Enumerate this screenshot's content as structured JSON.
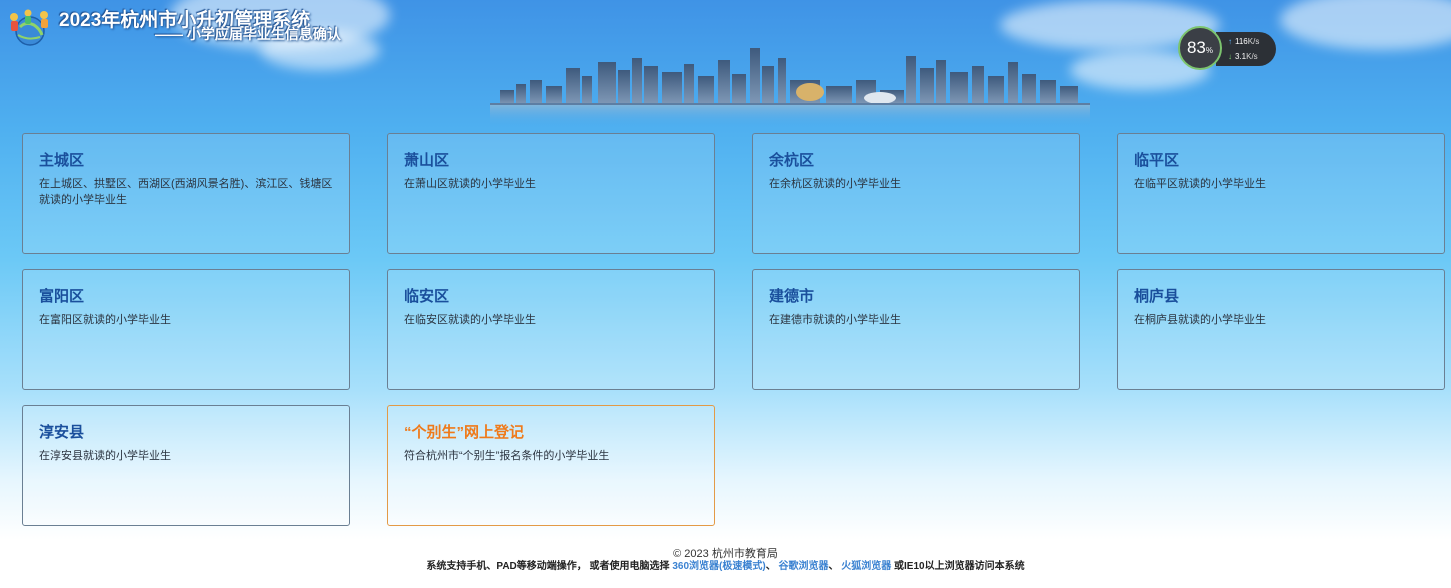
{
  "header": {
    "title": "2023年杭州市小升初管理系统",
    "subtitle": "—— 小学应届毕业生信息确认"
  },
  "net_widget": {
    "percent": "83",
    "percent_unit": "%",
    "upload": "116",
    "upload_unit": "K/s",
    "download": "3.1",
    "download_unit": "K/s"
  },
  "districts": [
    {
      "title": "主城区",
      "desc": "在上城区、拱墅区、西湖区(西湖风景名胜)、滨江区、钱塘区就读的小学毕业生"
    },
    {
      "title": "萧山区",
      "desc": "在萧山区就读的小学毕业生"
    },
    {
      "title": "余杭区",
      "desc": "在余杭区就读的小学毕业生"
    },
    {
      "title": "临平区",
      "desc": "在临平区就读的小学毕业生"
    },
    {
      "title": "富阳区",
      "desc": "在富阳区就读的小学毕业生"
    },
    {
      "title": "临安区",
      "desc": "在临安区就读的小学毕业生"
    },
    {
      "title": "建德市",
      "desc": "在建德市就读的小学毕业生"
    },
    {
      "title": "桐庐县",
      "desc": "在桐庐县就读的小学毕业生"
    },
    {
      "title": "淳安县",
      "desc": "在淳安县就读的小学毕业生"
    },
    {
      "title": "“个别生”网上登记",
      "desc": "符合杭州市“个别生”报名条件的小学毕业生"
    }
  ],
  "footer": {
    "copyright": "© 2023 杭州市教育局",
    "note_prefix": "系统支持手机、PAD等移动端操作， 或者使用电脑选择",
    "browser_360": "360浏览器(极速模式)",
    "sep1": "、",
    "browser_chrome": "谷歌浏览器",
    "sep2": "、",
    "browser_firefox": "火狐浏览器",
    "note_suffix": "或IE10以上浏览器访问本系统"
  },
  "colors": {
    "card_title": "#1a4f9c",
    "special_title": "#ef7a1a",
    "link": "#3b82d1"
  }
}
